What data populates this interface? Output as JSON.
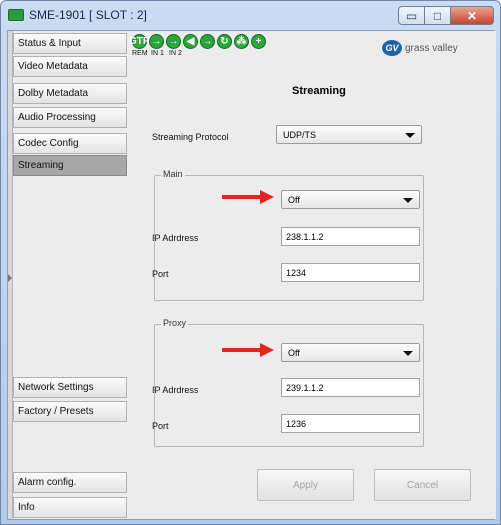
{
  "window": {
    "title": "SME-1901 [ SLOT : 2]",
    "buttons": {
      "minimize": "▭",
      "maximize": "□",
      "close": "✕"
    }
  },
  "sidebar": {
    "items": [
      {
        "label": "Status & Input",
        "active": false
      },
      {
        "label": "Video Metadata",
        "active": false
      },
      {
        "label": "Dolby Metadata",
        "active": false
      },
      {
        "label": "Audio Processing",
        "active": false
      },
      {
        "label": "Codec Config",
        "active": false
      },
      {
        "label": "Streaming",
        "active": true
      },
      {
        "label": "Network Settings",
        "active": false
      },
      {
        "label": "Factory / Presets",
        "active": false
      },
      {
        "label": "Alarm config.",
        "active": false
      },
      {
        "label": "Info",
        "active": false
      }
    ]
  },
  "status_bar": {
    "first_icon_text": "GTR",
    "captions": [
      "REM",
      "IN 1",
      "IN 2"
    ],
    "icon_names": [
      "gtr-status-icon",
      "in1-arrow-icon",
      "in2-arrow-icon",
      "status-icon-4",
      "status-icon-5",
      "status-icon-6",
      "network-icon",
      "add-icon"
    ]
  },
  "logo": {
    "mark": "GV",
    "text": "grass valley"
  },
  "panel": {
    "title": "Streaming",
    "protocol_label": "Streaming Protocol",
    "protocol_value": "UDP/TS",
    "main": {
      "legend": "Main",
      "state": "Off",
      "ip_label": "IP Adrdress",
      "ip_value": "238.1.1.2",
      "port_label": "Port",
      "port_value": "1234"
    },
    "proxy": {
      "legend": "Proxy",
      "state": "Off",
      "ip_label": "IP Adrdress",
      "ip_value": "239.1.1.2",
      "port_label": "Port",
      "port_value": "1236"
    },
    "apply_label": "Apply",
    "cancel_label": "Cancel"
  },
  "colors": {
    "status_green": "#2ca53d",
    "annotation_red": "#e3261d",
    "active_tab": "#a7a7a7",
    "brand_blue": "#1f62a8"
  }
}
